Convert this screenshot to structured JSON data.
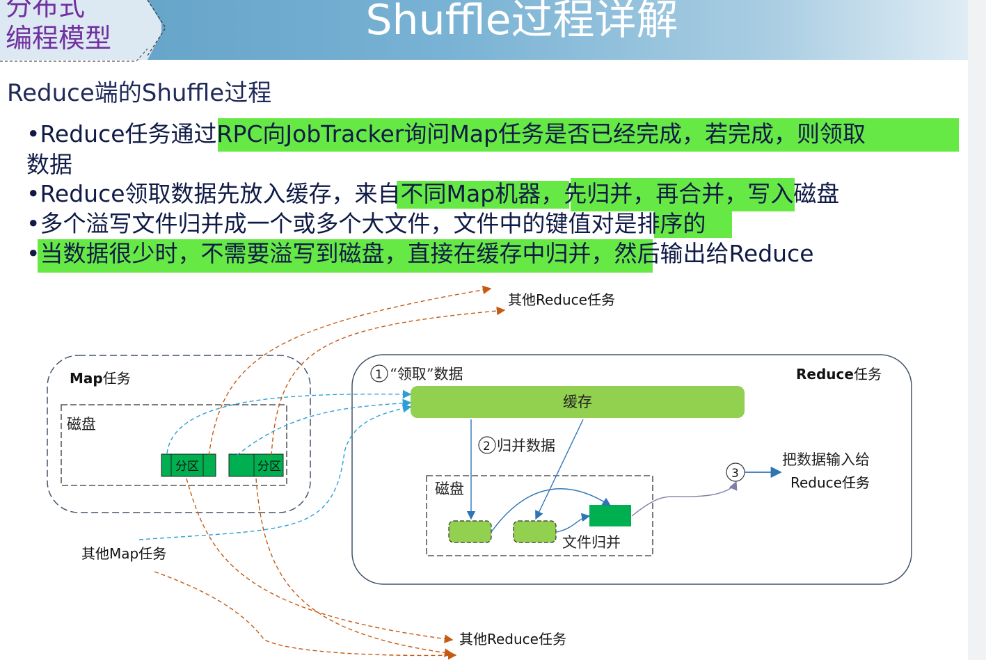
{
  "header": {
    "tab_line1": "分布式",
    "tab_line2": "编程模型",
    "title": "Shuffle过程详解"
  },
  "subtitle": "Reduce端的Shuffle过程",
  "bullets": {
    "b1_a": "•Reduce任务通过",
    "b1_b": "RPC向JobTracker询问Map任务是否已经完成，若完成，则领取",
    "b1_c": "数据",
    "b2_a": "•Reduce领取数据先放入缓存，来",
    "b2_b": "自不同Map机器",
    "b2_c": "，先归并，再合并，",
    "b2_d": "写入磁盘",
    "b3_a": "•多个溢写文件归并成一个或多个大文件，文件中的",
    "b3_b": "键值对是排序的",
    "b4_a": "•",
    "b4_b": "当数据很少时，不需要溢写到磁盘，直接在缓存中归并，",
    "b4_c": "然后输出给Reduce"
  },
  "diagram": {
    "map_box": {
      "title_bold": "Map",
      "title_rest": "任务",
      "disk": "磁盘",
      "partition": "分区"
    },
    "reduce_box": {
      "title_bold": "Reduce",
      "title_rest": "任务",
      "disk": "磁盘",
      "cache": "缓存"
    },
    "steps": {
      "s1": "1",
      "s1_label": "“领取”数据",
      "s2": "2",
      "s2_label": "归并数据",
      "s3": "3"
    },
    "file_merge": "文件归并",
    "output_line1": "把数据输入给",
    "output_line2": "Reduce任务",
    "other_reduce_top": "其他Reduce任务",
    "other_reduce_bottom": "其他Reduce任务",
    "other_map": "其他Map任务"
  },
  "colors": {
    "highlight": "#66e945",
    "cache_fill": "#92d050",
    "partition_fill": "#00b050",
    "orange_arrow": "#c55a11",
    "blue_arrow": "#2e9fd6",
    "dark_blue_arrow": "#2e75b6",
    "purple_arrow": "#7f7fa8",
    "title_purple": "#7030a0"
  }
}
